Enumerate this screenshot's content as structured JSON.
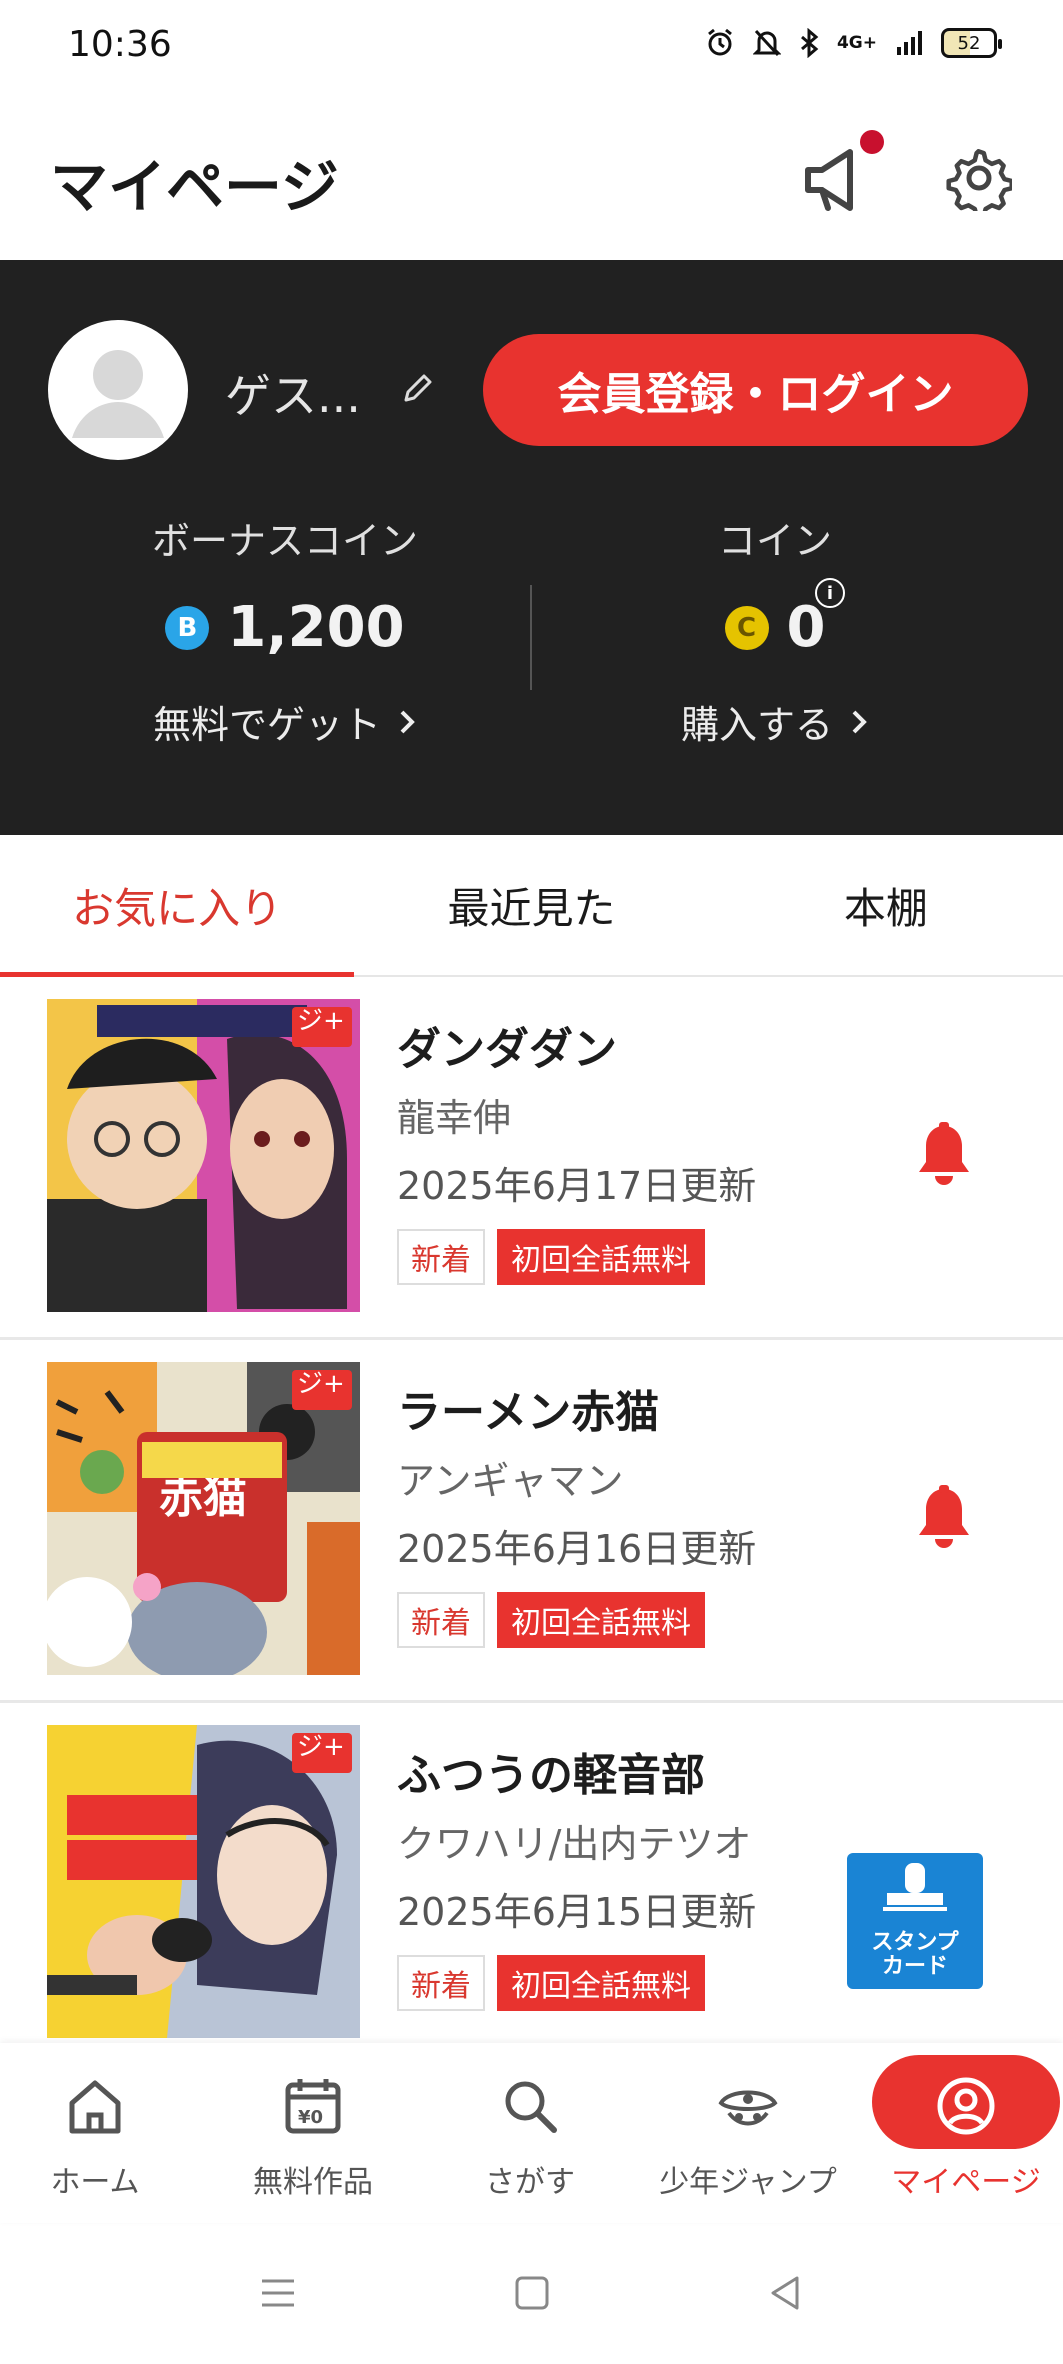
{
  "status_bar": {
    "time": "10:36",
    "network": "4G+",
    "battery": "52"
  },
  "header": {
    "title": "マイページ"
  },
  "profile": {
    "username": "ゲス...",
    "login_button": "会員登録・ログイン",
    "bonus_coin": {
      "label": "ボーナスコイン",
      "badge": "B",
      "value": "1,200",
      "link": "無料でゲット"
    },
    "coin": {
      "label": "コイン",
      "badge": "C",
      "value": "0",
      "link": "購入する",
      "info": "i"
    }
  },
  "tabs": [
    {
      "label": "お気に入り",
      "active": true
    },
    {
      "label": "最近見た",
      "active": false
    },
    {
      "label": "本棚",
      "active": false
    }
  ],
  "items": [
    {
      "title": "ダンダダン",
      "author": "龍幸伸",
      "date": "2025年6月17日更新",
      "tag_new": "新着",
      "tag_free": "初回全話無料",
      "bell": true
    },
    {
      "title": "ラーメン赤猫",
      "author": "アンギャマン",
      "date": "2025年6月16日更新",
      "tag_new": "新着",
      "tag_free": "初回全話無料",
      "bell": true
    },
    {
      "title": "ふつうの軽音部",
      "author": "クワハリ/出内テツオ",
      "date": "2025年6月15日更新",
      "tag_new": "新着",
      "tag_free": "初回全話無料",
      "bell": false
    }
  ],
  "stamp_card": {
    "line1": "スタンプ",
    "line2": "カード"
  },
  "bottom_nav": [
    {
      "label": "ホーム",
      "icon": "home-icon"
    },
    {
      "label": "無料作品",
      "icon": "calendar-free-icon"
    },
    {
      "label": "さがす",
      "icon": "search-icon"
    },
    {
      "label": "少年ジャンプ",
      "icon": "jump-pirate-icon"
    },
    {
      "label": "マイページ",
      "icon": "person-icon",
      "active": true
    }
  ],
  "colors": {
    "accent": "#e8332f",
    "dark_panel": "#212121",
    "bonus_coin": "#2aa5e8",
    "coin": "#e5c300",
    "stamp_card": "#1a84d4"
  }
}
